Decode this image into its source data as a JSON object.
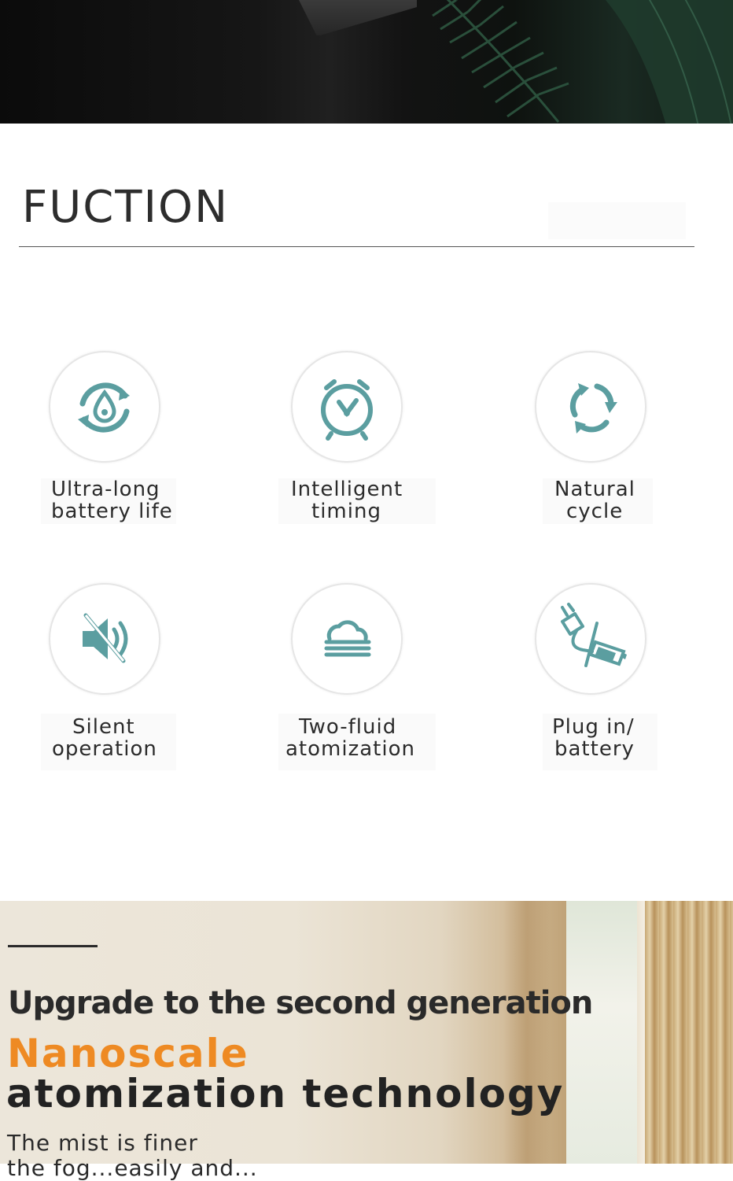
{
  "section": {
    "title": "FUCTION"
  },
  "features": [
    {
      "icon": "water-drop-cycle-icon",
      "line1": "Ultra-long",
      "line2": "battery life"
    },
    {
      "icon": "alarm-clock-icon",
      "line1": "Intelligent",
      "line2": "timing"
    },
    {
      "icon": "recycle-arrows-icon",
      "line1": "Natural",
      "line2": "cycle"
    },
    {
      "icon": "speaker-mute-icon",
      "line1": "Silent",
      "line2": "operation"
    },
    {
      "icon": "cloud-mist-icon",
      "line1": "Two-fluid",
      "line2": "atomization"
    },
    {
      "icon": "plug-battery-icon",
      "line1": "Plug in/",
      "line2": "battery"
    }
  ],
  "promo": {
    "heading": "Upgrade to the second generation",
    "accent": "Nanoscale",
    "subheading": "atomization technology",
    "description": "The mist is finer",
    "description_cut": "the fog...easily and..."
  },
  "colors": {
    "icon_teal": "#5b9ea0",
    "accent_orange": "#ee8a23",
    "text_dark": "#2b2b2b"
  }
}
